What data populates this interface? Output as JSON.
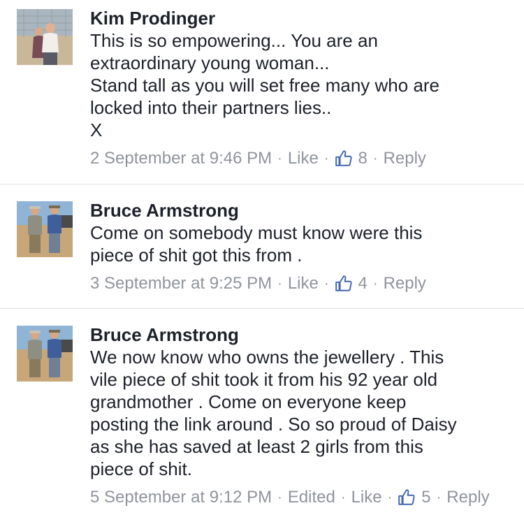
{
  "comments": [
    {
      "author": "Kim Prodinger",
      "lines": [
        "This is so empowering... You are an",
        "extraordinary young woman...",
        "Stand tall as you will set free many who are",
        "locked into their partners lies..",
        "X"
      ],
      "timestamp": "2 September at 9:46 PM",
      "like_label": "Like",
      "like_count": "8",
      "reply_label": "Reply",
      "icons": {
        "avatar": "couple-photo",
        "like": "thumbs-up-icon"
      }
    },
    {
      "author": "Bruce Armstrong",
      "lines": [
        "Come on somebody must know were this",
        "piece of shit got this from ."
      ],
      "timestamp": "3 September at 9:25 PM",
      "like_label": "Like",
      "like_count": "4",
      "reply_label": "Reply",
      "icons": {
        "avatar": "two-men-outback-photo",
        "like": "thumbs-up-icon"
      }
    },
    {
      "author": "Bruce Armstrong",
      "lines": [
        "We now know who owns the jewellery . This",
        "vile piece of shit took it from his 92 year old",
        "grandmother . Come on everyone keep",
        "posting the link around . So so proud of Daisy",
        "as she has saved at least 2 girls from this",
        "piece of shit."
      ],
      "timestamp": "5 September at 9:12 PM",
      "edited_label": "Edited",
      "like_label": "Like",
      "like_count": "5",
      "reply_label": "Reply",
      "icons": {
        "avatar": "two-men-outback-photo",
        "like": "thumbs-up-icon"
      }
    }
  ],
  "colors": {
    "text": "#1d2129",
    "meta": "#90949c",
    "like_icon": "#4267b2",
    "divider": "#dadde1"
  }
}
